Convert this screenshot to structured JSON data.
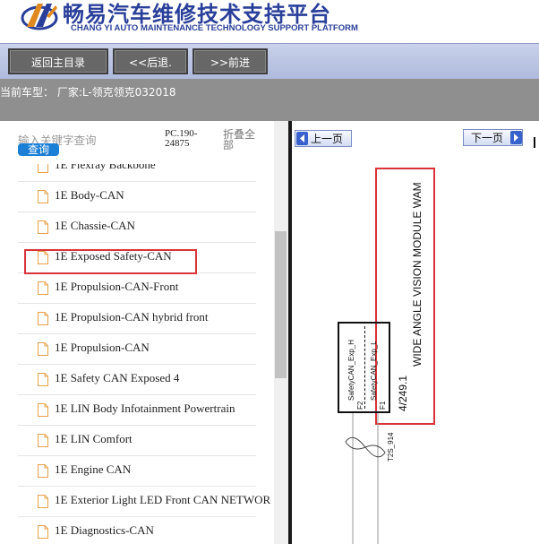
{
  "header": {
    "title_cn": "畅易汽车维修技术支持平台",
    "title_en": "CHANG YI AUTO MAINTENANCE TECHNOLOGY SUPPORT PLATFORM"
  },
  "nav": {
    "home": "返回主目录",
    "back": "<<后退.",
    "forward": ">>前进"
  },
  "info": {
    "current_model": "当前车型： 厂家:L-领克领克032018"
  },
  "search": {
    "placeholder": "输入关键字查询",
    "button": "查询",
    "code": "PC.190-24875",
    "collapse_all": "折叠全部"
  },
  "tree": [
    {
      "label": "1E Flexray Backbone"
    },
    {
      "label": "1E Body-CAN"
    },
    {
      "label": "1E Chassie-CAN"
    },
    {
      "label": "1E Exposed Safety-CAN"
    },
    {
      "label": "1E Propulsion-CAN-Front"
    },
    {
      "label": "1E Propulsion-CAN hybrid front"
    },
    {
      "label": "1E Propulsion-CAN"
    },
    {
      "label": "1E Safety CAN Exposed 4"
    },
    {
      "label": "1E LIN Body Infotainment Powertrain"
    },
    {
      "label": "1E LIN Comfort"
    },
    {
      "label": "1E Engine CAN"
    },
    {
      "label": "1E Exterior Light LED Front CAN NETWOR"
    },
    {
      "label": "1E Diagnostics-CAN"
    }
  ],
  "pager": {
    "prev": "上一页",
    "next": "下一页"
  },
  "diagram": {
    "module_name": "WIDE ANGLE VISION MODULE WAM",
    "module_ref": "4/249.1",
    "pin1_label": "SafetyCAN_Exp_H",
    "pin1_num": "F2",
    "pin2_label": "SafetyCAN_Exp_L",
    "pin2_num": "F1",
    "wire_label": "T2S_914"
  },
  "colors": {
    "brand_blue": "#2a3f99",
    "highlight_red": "#d8343a",
    "search_button": "#1b7fd6"
  }
}
